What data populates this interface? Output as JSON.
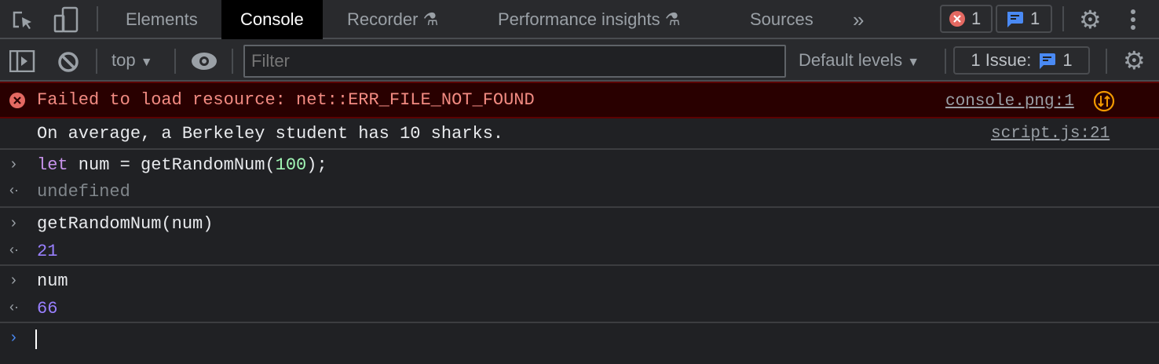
{
  "tabs": [
    "Elements",
    "Console",
    "Recorder",
    "Performance insights",
    "Sources"
  ],
  "more_tabs": "»",
  "error_count": "1",
  "message_count": "1",
  "toolbar": {
    "context": "top",
    "filter_placeholder": "Filter",
    "levels": "Default levels",
    "issues_label": "1 Issue:",
    "issues_count": "1"
  },
  "messages": [
    {
      "type": "error",
      "text": "Failed to load resource: net::ERR_FILE_NOT_FOUND",
      "source": "console.png:1"
    },
    {
      "type": "log",
      "text": "On average, a Berkeley student has 10 sharks.",
      "source": "script.js:21"
    }
  ],
  "entries": [
    {
      "input_kw": "let",
      "input_rest": " num = getRandomNum(",
      "input_num": "100",
      "input_end": ");",
      "output": "undefined"
    },
    {
      "input": "getRandomNum(num)",
      "output": "21"
    },
    {
      "input": "num",
      "output": "66"
    }
  ],
  "colors": {
    "error_bg": "#290000",
    "error_text": "#f28b82",
    "number": "#9980ff",
    "keyword": "#c792ea",
    "accent": "#1a73e8"
  }
}
